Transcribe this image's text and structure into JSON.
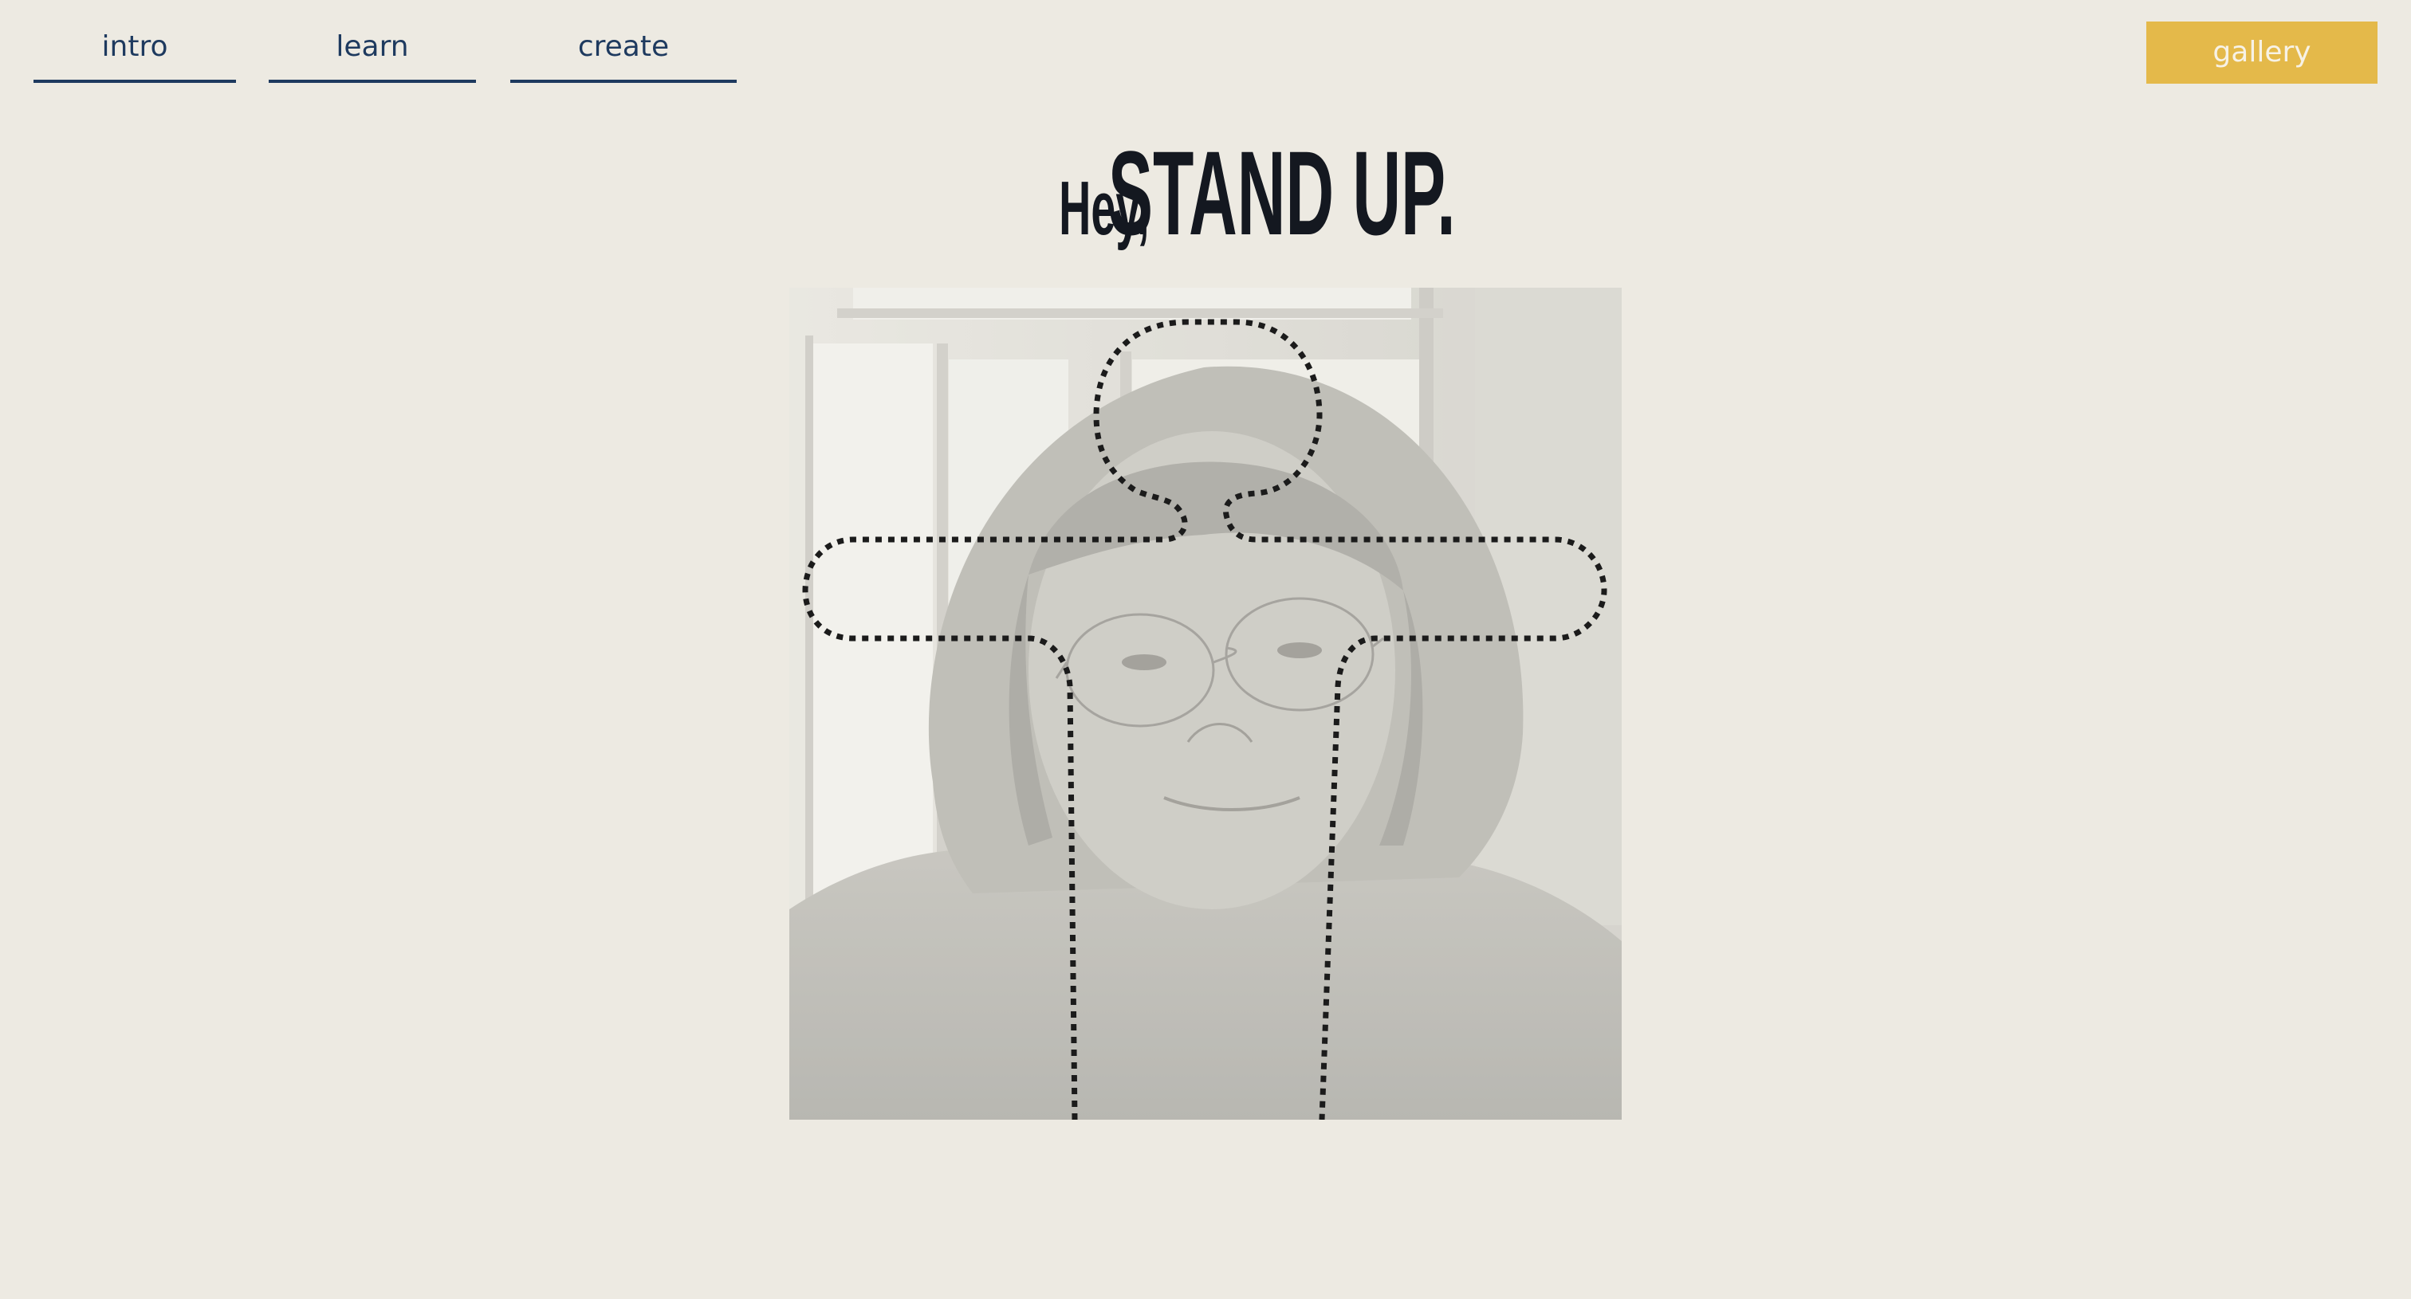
{
  "nav": {
    "tabs": [
      {
        "label": "intro"
      },
      {
        "label": "learn"
      },
      {
        "label": "create"
      }
    ],
    "gallery_label": "gallery"
  },
  "headline": {
    "greeting": "Hey,",
    "title": "STAND UP."
  },
  "photo": {
    "icon": "webcam-person-photo",
    "overlay": "dotted-standing-pose-outline"
  },
  "colors": {
    "background": "#edeae2",
    "nav_text": "#1e3a5f",
    "accent": "#e4b94a",
    "headline_text": "#141820"
  }
}
